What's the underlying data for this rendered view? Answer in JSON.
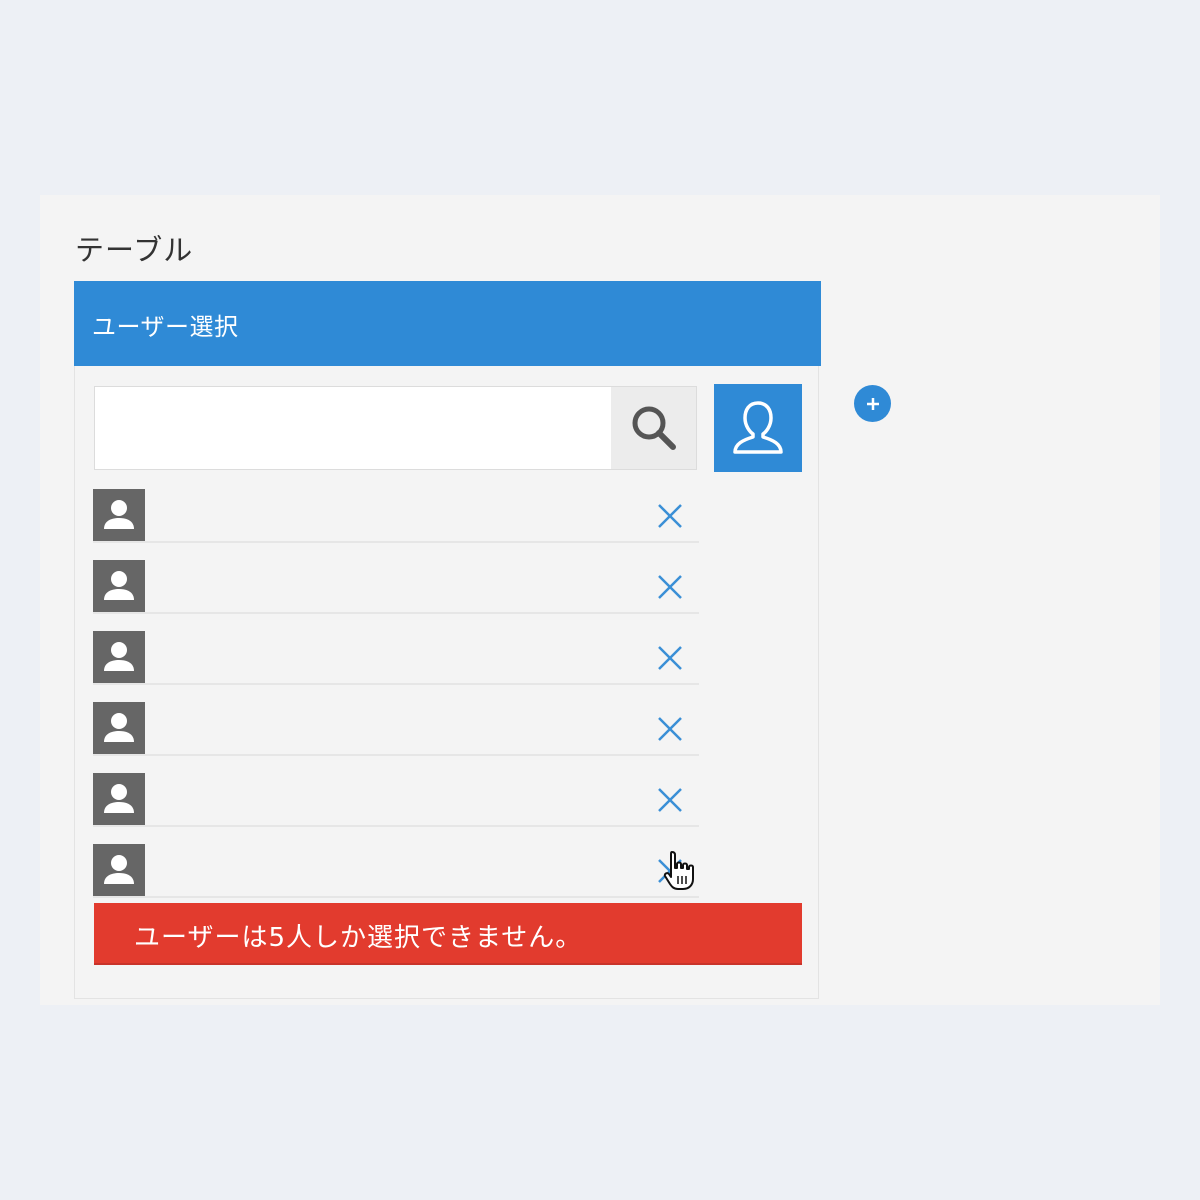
{
  "table": {
    "title": "テーブル",
    "header_label": "ユーザー選択"
  },
  "search": {
    "value": "",
    "placeholder": ""
  },
  "users": [
    {
      "name": ""
    },
    {
      "name": ""
    },
    {
      "name": ""
    },
    {
      "name": ""
    },
    {
      "name": ""
    },
    {
      "name": ""
    }
  ],
  "error": {
    "message": "ユーザーは5人しか選択できません。"
  },
  "colors": {
    "accent": "#2f8ad6",
    "error": "#e23b2e",
    "avatar": "#666666",
    "background": "#edf0f5",
    "panel": "#f4f4f4"
  },
  "icons": {
    "search": "search-icon",
    "user_picker": "user-outline-icon",
    "avatar": "user-silhouette-icon",
    "remove": "close-icon",
    "add": "plus-icon",
    "cursor": "hand-cursor-icon"
  }
}
